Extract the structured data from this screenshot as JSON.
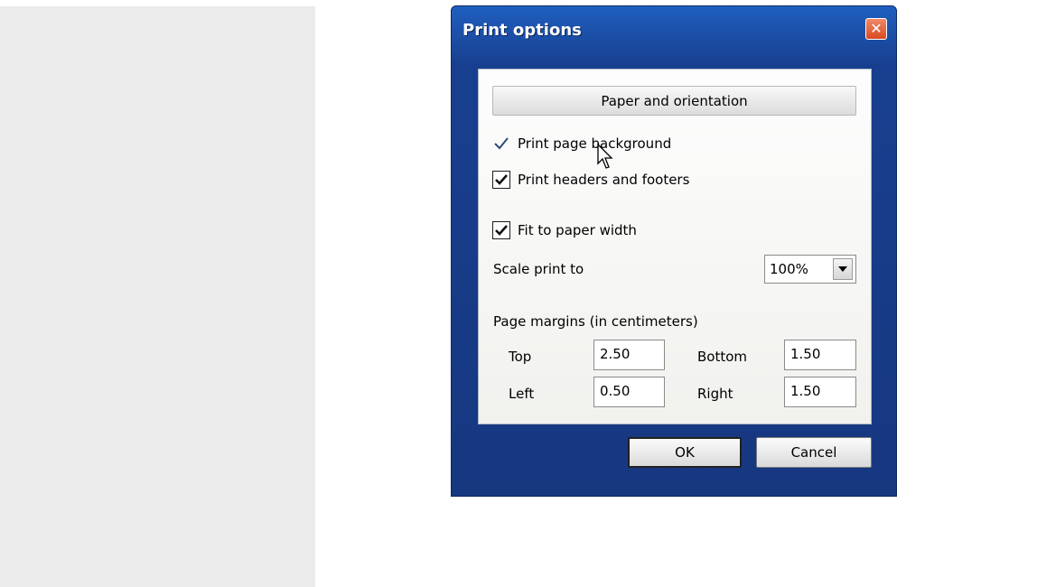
{
  "dialog": {
    "title": "Print options",
    "close_symbol": "✕",
    "paper_button": "Paper and orientation",
    "options": {
      "print_background": {
        "label": "Print page background",
        "checked": true
      },
      "print_headers": {
        "label": "Print headers and footers",
        "checked": true
      },
      "fit_width": {
        "label": "Fit to paper width",
        "checked": true
      }
    },
    "scale": {
      "label": "Scale print to",
      "value": "100%"
    },
    "margins": {
      "heading": "Page margins (in centimeters)",
      "top_label": "Top",
      "top_value": "2.50",
      "bottom_label": "Bottom",
      "bottom_value": "1.50",
      "left_label": "Left",
      "left_value": "0.50",
      "right_label": "Right",
      "right_value": "1.50"
    },
    "ok_label": "OK",
    "cancel_label": "Cancel"
  },
  "icons": [
    "close-icon",
    "checkmark-icon",
    "dropdown-arrow-icon",
    "mouse-cursor-icon"
  ],
  "colors": {
    "titlebar": "#1f5fbf",
    "close_button": "#d84a22",
    "panel": "#f5f5f3"
  }
}
